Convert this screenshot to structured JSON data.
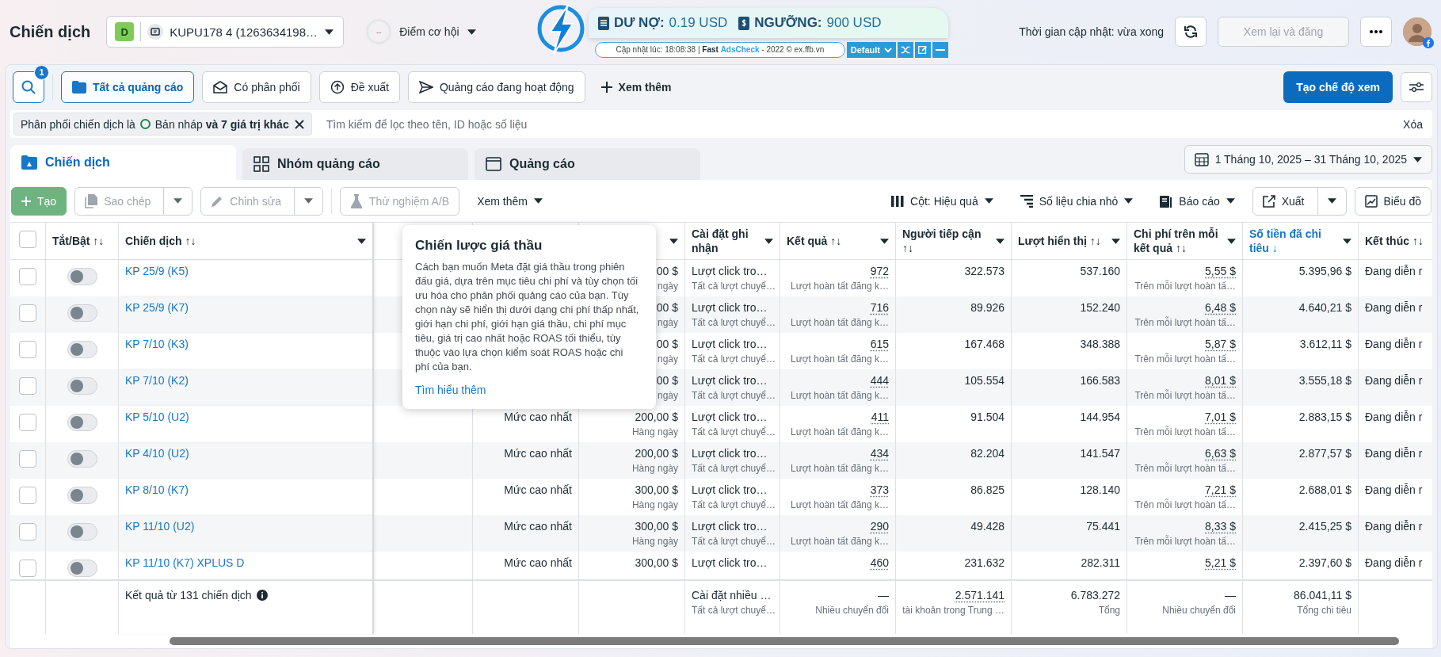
{
  "header": {
    "title": "Chiến dịch",
    "account": {
      "badge": "D",
      "name": "KUPU178 4 (1263634198…"
    },
    "opportunity": {
      "score": "--",
      "label": "Điểm cơ hội"
    },
    "updated": "Thời gian cập nhật: vừa xong",
    "review_button": {
      "label": "Xem lại và đăng",
      "disabled": true
    }
  },
  "extension": {
    "debt_label": "DƯ NỢ:",
    "debt": "0.19 USD",
    "limit_label": "NGƯỠNG:",
    "limit": "900 USD",
    "status": "Cập nhật lúc: 18:08:38 | **Fast** **AdsCheck** - 2022 © ex.ffb.vn",
    "preset": "Default"
  },
  "search_badge": "1",
  "filter_tabs": [
    {
      "label": "Tất cả quảng cáo",
      "selected": true
    },
    {
      "label": "Có phân phối",
      "selected": false
    },
    {
      "label": "Đề xuất",
      "selected": false
    },
    {
      "label": "Quảng cáo đang hoạt động",
      "selected": false
    }
  ],
  "more_filters": "Xem thêm",
  "create_view": "Tạo chế độ xem",
  "filter": {
    "chip_label": "Phân phối chiến dịch là",
    "chip_value": "Bản nháp **và 7 giá trị khác**",
    "placeholder": "Tìm kiếm để lọc theo tên, ID hoặc số liệu",
    "clear": "Xóa"
  },
  "level_tabs": [
    {
      "label": "Chiến dịch",
      "selected": true
    },
    {
      "label": "Nhóm quảng cáo",
      "selected": false
    },
    {
      "label": "Quảng cáo",
      "selected": false
    }
  ],
  "date_range": "1 Tháng 10, 2025 – 31 Tháng 10, 2025",
  "actions": [
    {
      "kind": "create",
      "label": "Tạo",
      "disabled": true
    },
    {
      "kind": "split",
      "label": "Sao chép",
      "disabled": true
    },
    {
      "kind": "split",
      "label": "Chỉnh sửa",
      "disabled": true
    },
    {
      "kind": "plain",
      "label": "Thử nghiệm A/B",
      "disabled": true
    },
    {
      "kind": "menu",
      "label": "Xem thêm",
      "disabled": false
    }
  ],
  "view_actions": [
    {
      "kind": "menu",
      "label": "Cột: Hiệu quả"
    },
    {
      "kind": "menu",
      "label": "Số liệu chia nhỏ"
    },
    {
      "kind": "menu",
      "label": "Báo cáo"
    },
    {
      "kind": "split",
      "label": "Xuất"
    },
    {
      "kind": "plain",
      "label": "Biểu đồ"
    }
  ],
  "table": {
    "columns": [
      {
        "kind": "checkbox",
        "checked": false
      },
      {
        "kind": "text",
        "label": "Tắt/Bật ↑↓",
        "sorted": false,
        "menu": false
      },
      {
        "kind": "text",
        "label": "Chiến dịch ↑↓",
        "sorted": false,
        "menu": true
      },
      {
        "kind": "blank"
      },
      {
        "kind": "blank"
      },
      {
        "kind": "text",
        "menu": true
      },
      {
        "kind": "text",
        "label": "Cài đặt ghi nhận",
        "sorted": false,
        "menu": true
      },
      {
        "kind": "text",
        "label": "Kết quả ↑↓",
        "sorted": false,
        "menu": true
      },
      {
        "kind": "text",
        "label": "Người tiếp cận ↑↓",
        "sorted": false,
        "menu": true
      },
      {
        "kind": "text",
        "label": "Lượt hiển thị ↑↓",
        "sorted": false,
        "menu": true
      },
      {
        "kind": "text",
        "label": "Chi phí trên mỗi kết quả ↑↓",
        "sorted": false,
        "menu": true
      },
      {
        "kind": "text",
        "label": "Số tiền đã chi tiêu ↓",
        "sorted": true,
        "menu": true
      },
      {
        "kind": "text",
        "label": "Kết thúc ↑↓",
        "sorted": false,
        "menu": false
      }
    ],
    "rows": [
      {
        "checked": false,
        "on": false,
        "name": "KP 25/9 (K5)",
        "budget": {
          "value": "00 $",
          "sub": "ngày"
        },
        "attribution": {
          "value": "Lượt click tro…",
          "sub": "Tất cả lượt chuyể…"
        },
        "results": {
          "value": "972",
          "sub": "Lượt hoàn tất đăng k…"
        },
        "reach": "322.573",
        "impressions": "537.160",
        "cost_per_result": {
          "value": "5,55 $",
          "sub": "Trên mỗi lượt hoàn tấ…"
        },
        "amount_spent": "5.395,96 $",
        "ends": "Đang diễn r"
      },
      {
        "checked": false,
        "on": false,
        "name": "KP 25/9 (K7)",
        "budget": {
          "value": "00 $",
          "sub": "ngày"
        },
        "attribution": {
          "value": "Lượt click tro…",
          "sub": "Tất cả lượt chuyể…"
        },
        "results": {
          "value": "716",
          "sub": "Lượt hoàn tất đăng k…"
        },
        "reach": "89.926",
        "impressions": "152.240",
        "cost_per_result": {
          "value": "6,48 $",
          "sub": "Trên mỗi lượt hoàn tấ…"
        },
        "amount_spent": "4.640,21 $",
        "ends": "Đang diễn r"
      },
      {
        "checked": false,
        "on": false,
        "name": "KP 7/10 (K3)",
        "budget": {
          "value": "00 $",
          "sub": "ngày"
        },
        "attribution": {
          "value": "Lượt click tro…",
          "sub": "Tất cả lượt chuyể…"
        },
        "results": {
          "value": "615",
          "sub": "Lượt hoàn tất đăng k…"
        },
        "reach": "167.468",
        "impressions": "348.388",
        "cost_per_result": {
          "value": "5,87 $",
          "sub": "Trên mỗi lượt hoàn tấ…"
        },
        "amount_spent": "3.612,11 $",
        "ends": "Đang diễn r"
      },
      {
        "checked": false,
        "on": false,
        "name": "KP 7/10 (K2)",
        "budget": {
          "value": "00 $",
          "sub": "ngày"
        },
        "attribution": {
          "value": "Lượt click tro…",
          "sub": "Tất cả lượt chuyể…"
        },
        "results": {
          "value": "444",
          "sub": "Lượt hoàn tất đăng k…"
        },
        "reach": "105.554",
        "impressions": "166.583",
        "cost_per_result": {
          "value": "8,01 $",
          "sub": "Trên mỗi lượt hoàn tấ…"
        },
        "amount_spent": "3.555,18 $",
        "ends": "Đang diễn r"
      },
      {
        "checked": false,
        "on": false,
        "name": "KP 5/10 (U2)",
        "bid_strategy": "Mức cao nhất",
        "budget": {
          "value": "200,00 $",
          "sub": "Hàng ngày"
        },
        "attribution": {
          "value": "Lượt click tro…",
          "sub": "Tất cả lượt chuyể…"
        },
        "results": {
          "value": "411",
          "sub": "Lượt hoàn tất đăng k…"
        },
        "reach": "91.504",
        "impressions": "144.954",
        "cost_per_result": {
          "value": "7,01 $",
          "sub": "Trên mỗi lượt hoàn tấ…"
        },
        "amount_spent": "2.883,15 $",
        "ends": "Đang diễn r"
      },
      {
        "checked": false,
        "on": false,
        "name": "KP 4/10 (U2)",
        "bid_strategy": "Mức cao nhất",
        "budget": {
          "value": "200,00 $",
          "sub": "Hàng ngày"
        },
        "attribution": {
          "value": "Lượt click tro…",
          "sub": "Tất cả lượt chuyể…"
        },
        "results": {
          "value": "434",
          "sub": "Lượt hoàn tất đăng k…"
        },
        "reach": "82.204",
        "impressions": "141.547",
        "cost_per_result": {
          "value": "6,63 $",
          "sub": "Trên mỗi lượt hoàn tấ…"
        },
        "amount_spent": "2.877,57 $",
        "ends": "Đang diễn r"
      },
      {
        "checked": false,
        "on": false,
        "name": "KP 8/10 (K7)",
        "bid_strategy": "Mức cao nhất",
        "budget": {
          "value": "300,00 $",
          "sub": "Hàng ngày"
        },
        "attribution": {
          "value": "Lượt click tro…",
          "sub": "Tất cả lượt chuyể…"
        },
        "results": {
          "value": "373",
          "sub": "Lượt hoàn tất đăng k…"
        },
        "reach": "86.825",
        "impressions": "128.140",
        "cost_per_result": {
          "value": "7,21 $",
          "sub": "Trên mỗi lượt hoàn tấ…"
        },
        "amount_spent": "2.688,01 $",
        "ends": "Đang diễn r"
      },
      {
        "checked": false,
        "on": false,
        "name": "KP 11/10 (U2)",
        "bid_strategy": "Mức cao nhất",
        "budget": {
          "value": "300,00 $",
          "sub": "Hàng ngày"
        },
        "attribution": {
          "value": "Lượt click tro…",
          "sub": "Tất cả lượt chuyể…"
        },
        "results": {
          "value": "290",
          "sub": "Lượt hoàn tất đăng k…"
        },
        "reach": "49.428",
        "impressions": "75.441",
        "cost_per_result": {
          "value": "8,33 $",
          "sub": "Trên mỗi lượt hoàn tấ…"
        },
        "amount_spent": "2.415,25 $",
        "ends": "Đang diễn r"
      },
      {
        "checked": false,
        "on": false,
        "name": "KP 11/10 (K7) XPLUS D",
        "bid_strategy": "Mức cao nhất",
        "budget": {
          "value": "300,00 $"
        },
        "attribution": {
          "value": "Lượt click tro…"
        },
        "results": {
          "value": "460"
        },
        "reach": "231.632",
        "impressions": "282.311",
        "cost_per_result": {
          "value": "5,21 $"
        },
        "amount_spent": "2.397,60 $",
        "ends": "Đang diễn r"
      }
    ],
    "footer": {
      "label": "Kết quả từ 131 chiến dịch",
      "attribution": {
        "value": "Cài đặt nhiều …",
        "sub": "Tất cả lượt chuyể…"
      },
      "results": {
        "value": "—",
        "sub": "Nhiều chuyển đổi"
      },
      "reach": {
        "value": "2.571.141",
        "sub": "tài khoản trong Trung …"
      },
      "impressions": {
        "value": "6.783.272",
        "sub": "Tổng"
      },
      "cost_per_result": {
        "value": "—",
        "sub": "Nhiều chuyển đổi"
      },
      "amount_spent": {
        "value": "86.041,11 $",
        "sub": "Tổng chi tiêu"
      }
    }
  },
  "tooltip": {
    "title": "Chiến lược giá thầu",
    "body": "Cách bạn muốn Meta đặt giá thầu trong phiên đấu giá, dựa trên mục tiêu chi phí và tùy chọn tối ưu hóa cho phân phối quảng cáo của bạn. Tùy chọn này sẽ hiển thị dưới dạng chi phí thấp nhất, giới hạn chi phí, giới hạn giá thầu, chi phí mục tiêu, giá trị cao nhất hoặc ROAS tối thiểu, tùy thuộc vào lựa chọn kiểm soát ROAS hoặc chi phí của bạn.",
    "link": "Tìm hiểu thêm"
  }
}
